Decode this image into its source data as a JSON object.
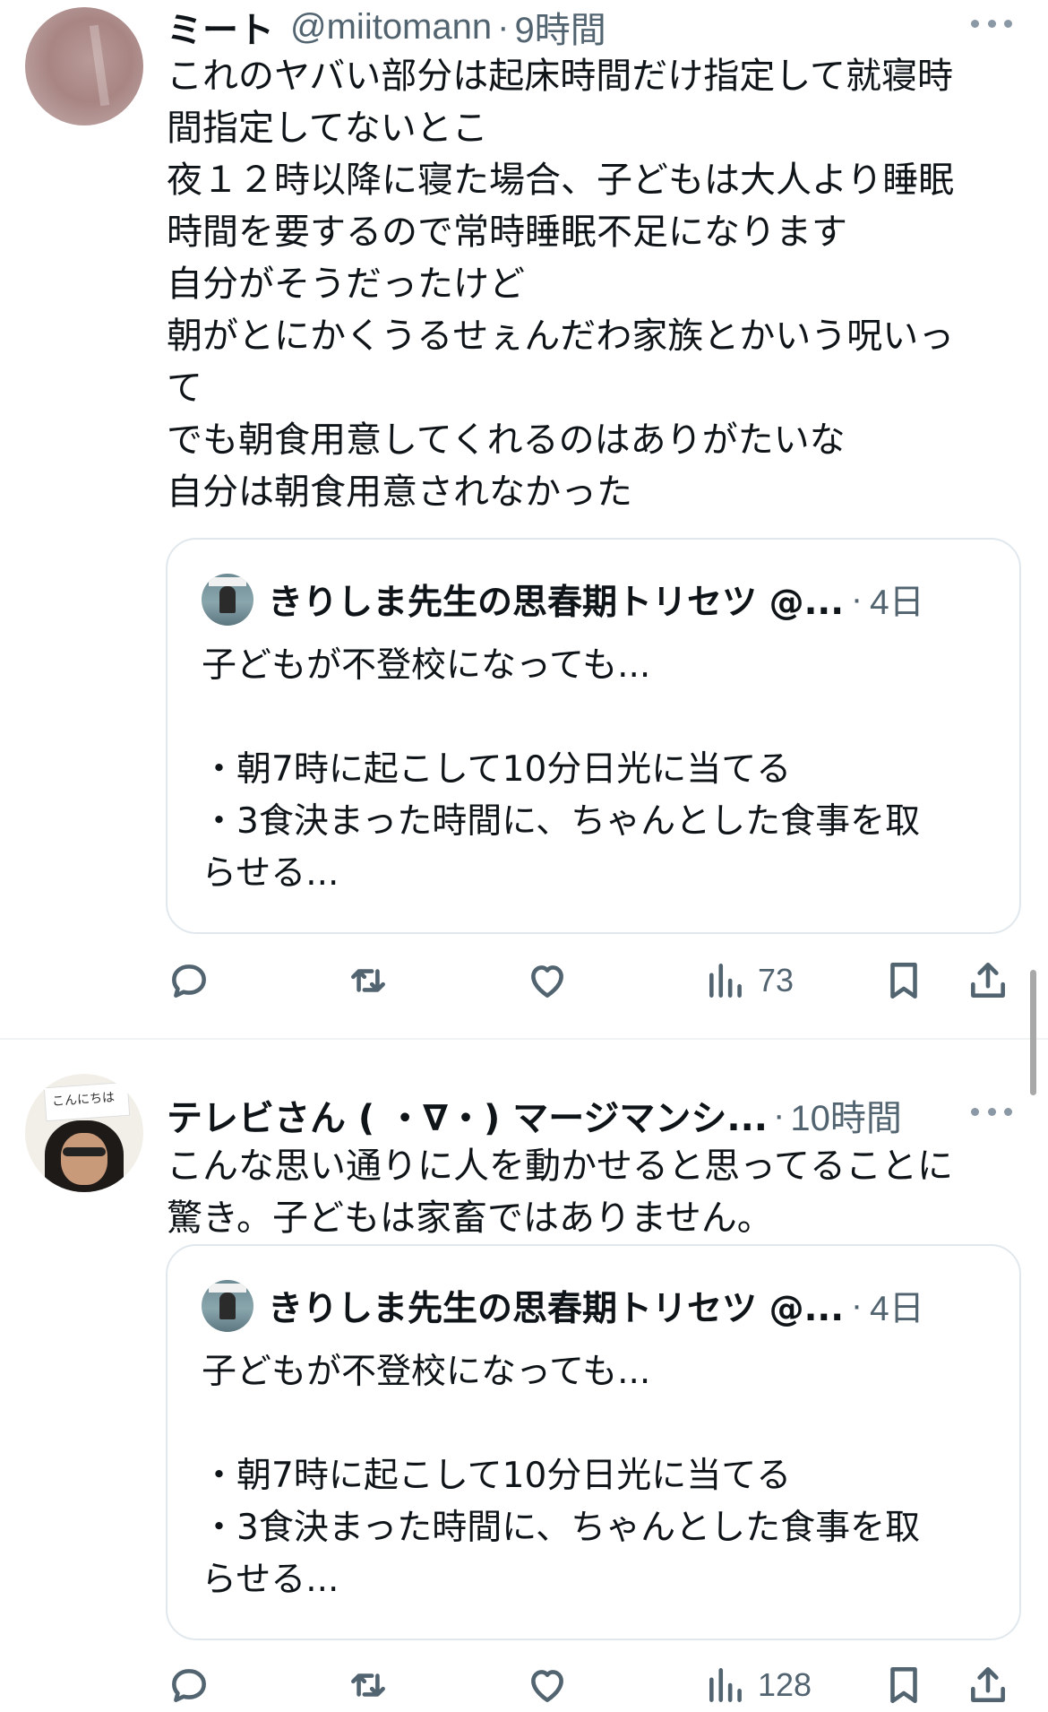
{
  "tweets": [
    {
      "display_name": "ミート",
      "handle": "@miitomann",
      "separator": "·",
      "time": "9時間",
      "text": "これのヤバい部分は起床時間だけ指定して就寝時\n間指定してないとこ\n夜１２時以降に寝た場合、子どもは大人より睡眠\n時間を要するので常時睡眠不足になります\n自分がそうだったけど\n朝がとにかくうるせぇんだわ家族とかいう呪いっ\nて\nでも朝食用意してくれるのはありがたいな\n自分は朝食用意されなかった",
      "quote": {
        "name": "きりしま先生の思春期トリセツ @...",
        "separator": "·",
        "time": "4日",
        "text": "子どもが不登校になっても...\n\n・朝7時に起こして10分日光に当てる\n・3食決まった時間に、ちゃんとした食事を取\nらせる..."
      },
      "views": "73"
    },
    {
      "display_name": "テレビさん ( ・∇・) マージマンシ...",
      "handle": "",
      "separator": "·",
      "time": "10時間",
      "avatar_sign": "こんにちは",
      "text": "こんな思い通りに人を動かせると思ってることに\n驚き。子どもは家畜ではありません。",
      "quote": {
        "name": "きりしま先生の思春期トリセツ @...",
        "separator": "·",
        "time": "4日",
        "text": "子どもが不登校になっても...\n\n・朝7時に起こして10分日光に当てる\n・3食決まった時間に、ちゃんとした食事を取\nらせる..."
      },
      "views": "128"
    }
  ],
  "icons": {
    "more": "more-horizontal-icon",
    "reply": "reply-icon",
    "retweet": "retweet-icon",
    "like": "heart-icon",
    "views": "views-chart-icon",
    "bookmark": "bookmark-icon",
    "share": "share-icon"
  },
  "colors": {
    "text_primary": "#0f1419",
    "text_secondary": "#536471",
    "border": "#e1e8ed",
    "divider": "#eff3f4"
  }
}
